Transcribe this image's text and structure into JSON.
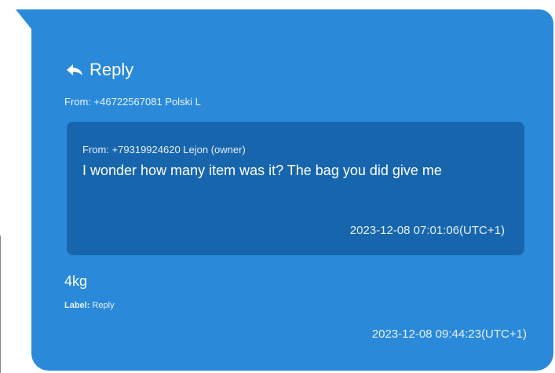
{
  "message": {
    "reply_heading": "Reply",
    "from": "From: +46722567081 Polski L",
    "body": "4kg",
    "label_key": "Label:",
    "label_value": "Reply",
    "timestamp": "2023-12-08 09:44:23(UTC+1)",
    "bubble_color": "#2a8ad9"
  },
  "quoted": {
    "from": "From: +79319924620 Lejon (owner)",
    "text": "I wonder how many item was it? The bag you did give me",
    "timestamp": "2023-12-08 07:01:06(UTC+1)",
    "box_color": "#1766ad"
  },
  "icons": {
    "reply": "reply-arrow-icon"
  }
}
